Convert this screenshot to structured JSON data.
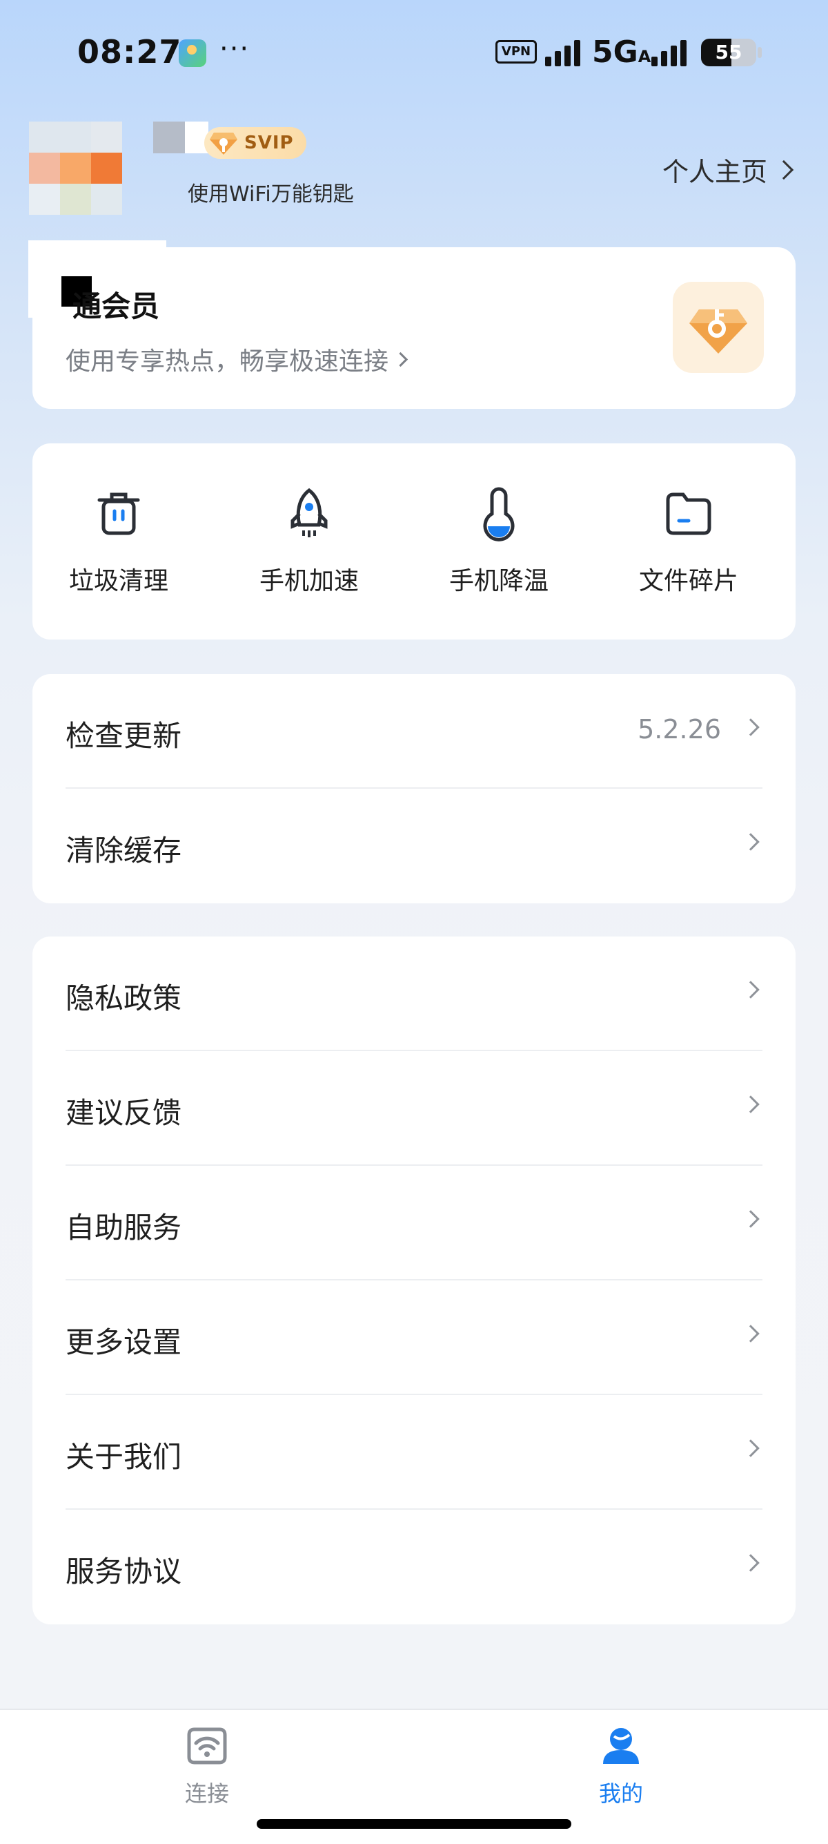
{
  "status_bar": {
    "time": "08:27",
    "more": "···",
    "vpn": "VPN",
    "network": "5G",
    "network_sub": "A",
    "battery": "55"
  },
  "profile": {
    "badge": "SVIP",
    "subtitle": "使用WiFi万能钥匙",
    "home_link": "个人主页"
  },
  "vip_card": {
    "title": "通会员",
    "subtitle": "使用专享热点，畅享极速连接"
  },
  "tools": [
    {
      "label": "垃圾清理",
      "icon": "trash-icon"
    },
    {
      "label": "手机加速",
      "icon": "rocket-icon"
    },
    {
      "label": "手机降温",
      "icon": "thermometer-icon"
    },
    {
      "label": "文件碎片",
      "icon": "folder-icon"
    }
  ],
  "update_section": {
    "items": [
      {
        "label": "检查更新",
        "value": "5.2.26"
      },
      {
        "label": "清除缓存",
        "value": ""
      }
    ]
  },
  "menu_section": {
    "items": [
      {
        "label": "隐私政策"
      },
      {
        "label": "建议反馈"
      },
      {
        "label": "自助服务"
      },
      {
        "label": "更多设置"
      },
      {
        "label": "关于我们"
      },
      {
        "label": "服务协议"
      }
    ]
  },
  "bottom_nav": {
    "items": [
      {
        "label": "连接",
        "icon": "wifi-icon",
        "active": false
      },
      {
        "label": "我的",
        "icon": "profile-icon",
        "active": true
      }
    ]
  },
  "colors": {
    "accent": "#1a7ef0",
    "vip_gold": "#f5a94a",
    "inactive": "#8a8e95"
  }
}
